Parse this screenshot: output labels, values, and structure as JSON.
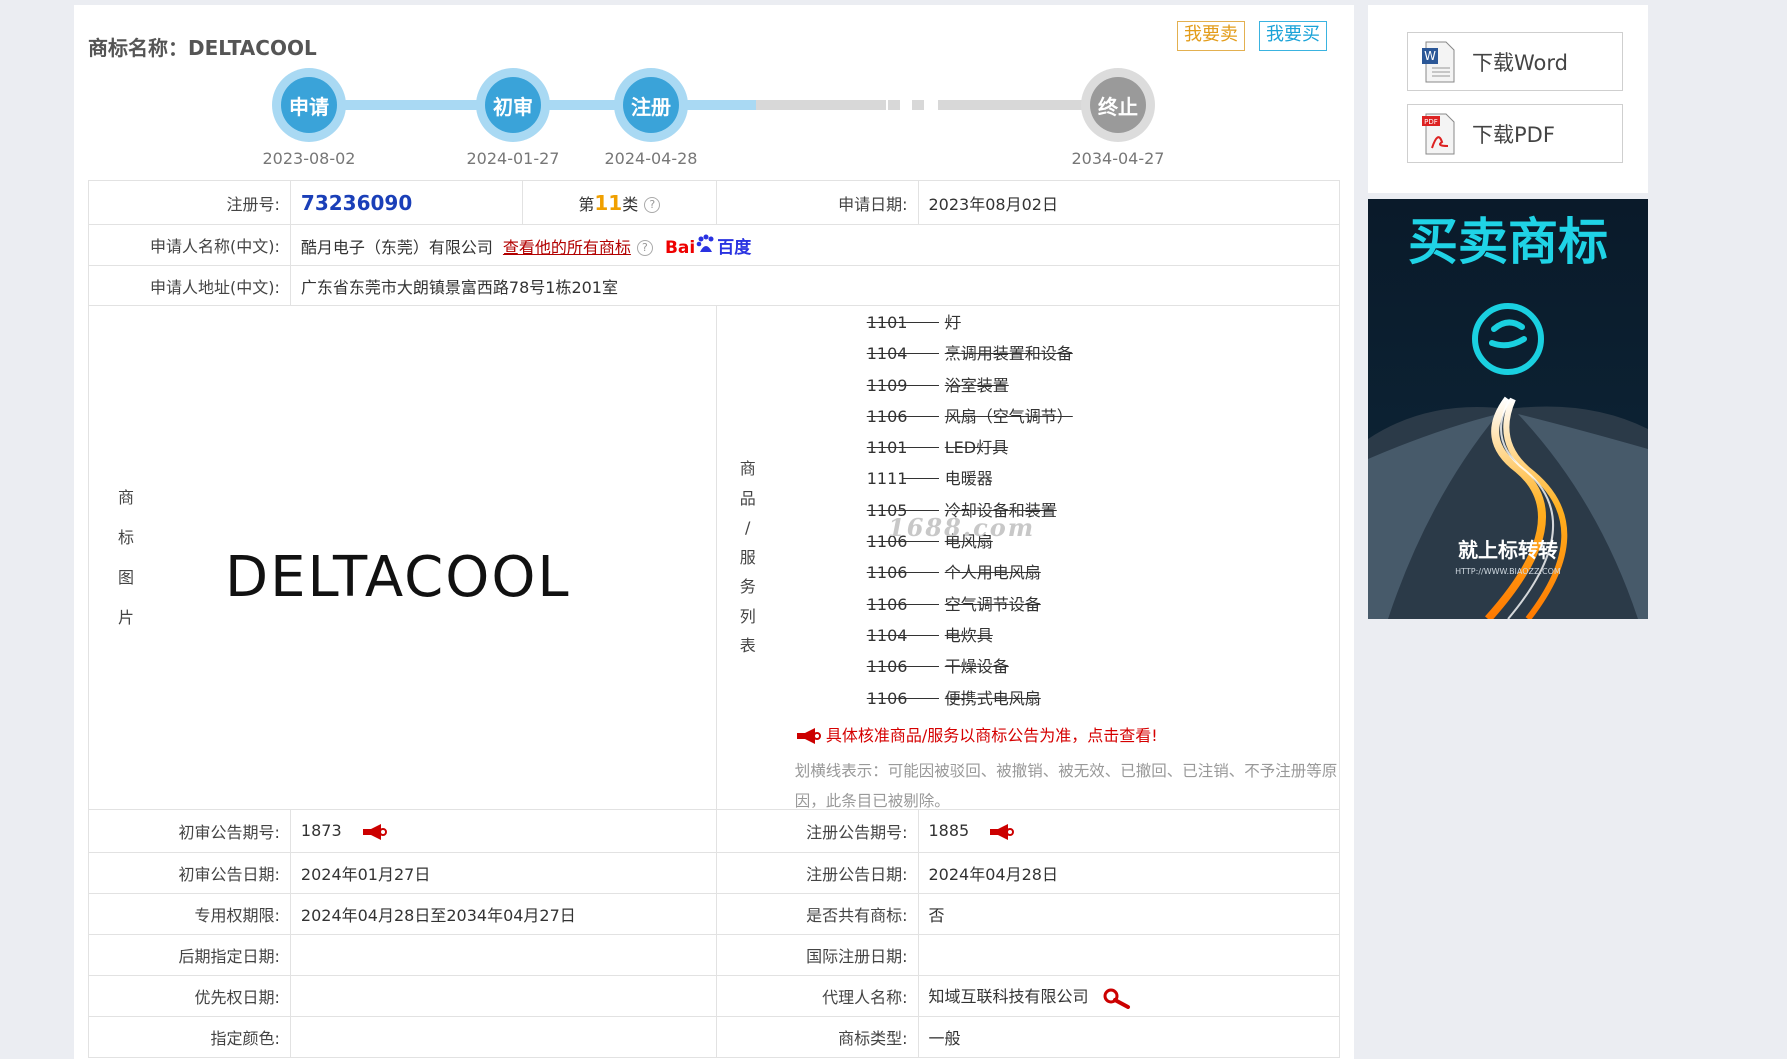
{
  "header": {
    "title": "商标名称：DELTACOOL",
    "sell_button": "我要卖",
    "buy_button": "我要买"
  },
  "timeline": {
    "steps": [
      {
        "label": "申请",
        "date": "2023-08-02",
        "state": "active"
      },
      {
        "label": "初审",
        "date": "2024-01-27",
        "state": "active"
      },
      {
        "label": "注册",
        "date": "2024-04-28",
        "state": "active"
      },
      {
        "label": "终止",
        "date": "2034-04-27",
        "state": "ended"
      }
    ]
  },
  "info": {
    "reg_no_label": "注册号:",
    "reg_no": "73236090",
    "class_prefix": "第",
    "class_num": "11",
    "class_suffix": "类",
    "apply_date_label": "申请日期:",
    "apply_date": "2023年08月02日",
    "applicant_name_label": "申请人名称(中文):",
    "applicant_name": "酷月电子（东莞）有限公司",
    "all_marks_link": "查看他的所有商标",
    "baidu_logo_text": "Bai",
    "baidu_logo_text2": "百度",
    "applicant_addr_label": "申请人地址(中文):",
    "applicant_addr": "广东省东莞市大朗镇景富西路78号1栋201室",
    "mark_image_label": [
      "商",
      "标",
      "图",
      "片"
    ],
    "mark_text": "DELTACOOL",
    "goods_label": [
      "商",
      "品",
      "/",
      "服",
      "务",
      "列",
      "表"
    ],
    "goods": [
      {
        "code": "1101",
        "name": "灯",
        "struck": true
      },
      {
        "code": "1104",
        "name": "烹调用装置和设备",
        "struck": true
      },
      {
        "code": "1109",
        "name": "浴室装置",
        "struck": true
      },
      {
        "code": "1106",
        "name": "风扇（空气调节）",
        "struck": true
      },
      {
        "code": "1101",
        "name": "LED灯具",
        "struck": true
      },
      {
        "code": "1111",
        "name": "电暖器",
        "struck": false
      },
      {
        "code": "1105",
        "name": "冷却设备和装置",
        "struck": true
      },
      {
        "code": "1106",
        "name": "电风扇",
        "struck": true
      },
      {
        "code": "1106",
        "name": "个人用电风扇",
        "struck": true
      },
      {
        "code": "1106",
        "name": "空气调节设备",
        "struck": true
      },
      {
        "code": "1104",
        "name": "电炊具",
        "struck": true
      },
      {
        "code": "1106",
        "name": "干燥设备",
        "struck": true
      },
      {
        "code": "1106",
        "name": "便携式电风扇",
        "struck": true
      }
    ],
    "goods_notice": "具体核准商品/服务以商标公告为准，点击查看!",
    "strike_note": "划横线表示：可能因被驳回、被撤销、被无效、已撤回、已注销、不予注册等原因，此条目已被剔除。",
    "watermark": "1688.com",
    "prelim_no_label": "初审公告期号:",
    "prelim_no": "1873",
    "reg_pub_no_label": "注册公告期号:",
    "reg_pub_no": "1885",
    "prelim_date_label": "初审公告日期:",
    "prelim_date": "2024年01月27日",
    "reg_pub_date_label": "注册公告日期:",
    "reg_pub_date": "2024年04月28日",
    "exclusive_label": "专用权期限:",
    "exclusive": "2024年04月28日至2034年04月27日",
    "shared_label": "是否共有商标:",
    "shared": "否",
    "later_label": "后期指定日期:",
    "later": "",
    "intl_label": "国际注册日期:",
    "intl": "",
    "priority_label": "优先权日期:",
    "priority": "",
    "agent_label": "代理人名称:",
    "agent": "知域互联科技有限公司",
    "color_label": "指定颜色:",
    "color": "",
    "type_label": "商标类型:",
    "type": "一般"
  },
  "sidebar": {
    "download_word": "下载Word",
    "download_pdf": "下载PDF",
    "ad_title": "买卖商标",
    "ad_slogan": "就上标转转",
    "ad_url": "HTTP://WWW.BIAOZZ.COM"
  },
  "colors": {
    "accent_blue": "#3aa3d9",
    "link_red": "#b20000",
    "class_orange": "#f0a000"
  }
}
